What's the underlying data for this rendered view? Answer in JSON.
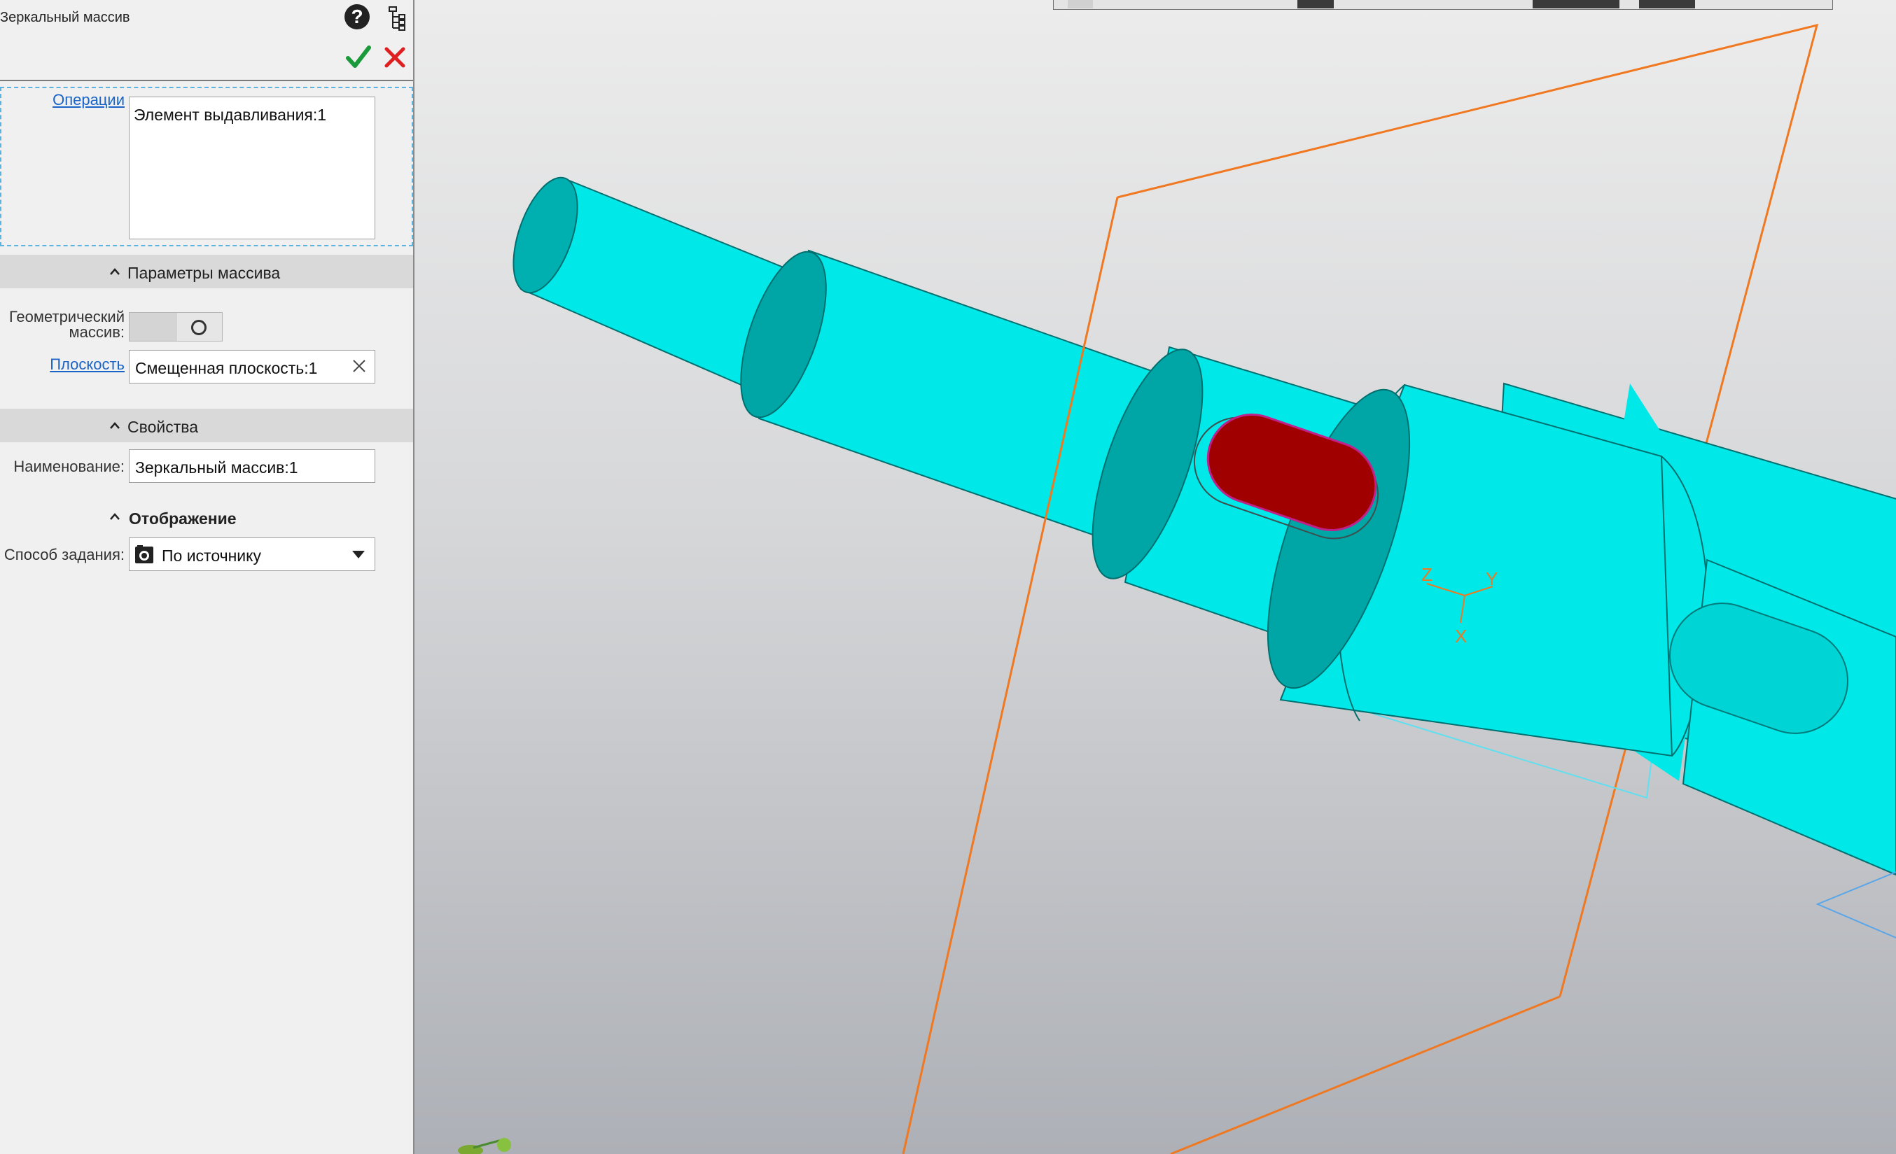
{
  "panel": {
    "title": "Зеркальный массив",
    "operations": {
      "label": "Операции",
      "items": [
        "Элемент выдавливания:1"
      ]
    },
    "array_params": {
      "title": "Параметры массива",
      "geometric_array_label": "Геометрический массив:",
      "geometric_array_on": false,
      "plane_label": "Плоскость",
      "plane_value": "Смещенная плоскость:1"
    },
    "properties": {
      "title": "Свойства",
      "name_label": "Наименование:",
      "name_value": "Зеркальный массив:1"
    },
    "display": {
      "title": "Отображение",
      "method_label": "Способ задания:",
      "method_value": "По источнику"
    }
  },
  "viewport": {
    "axis_labels": {
      "x": "X",
      "y": "Y",
      "z": "Z"
    },
    "colors": {
      "part": "#00e8e8",
      "part_shade": "#009e9e",
      "selected_feature": "#a00000",
      "plane": "#f07820",
      "accept": "#1a9a3a",
      "cancel": "#e02020"
    }
  }
}
